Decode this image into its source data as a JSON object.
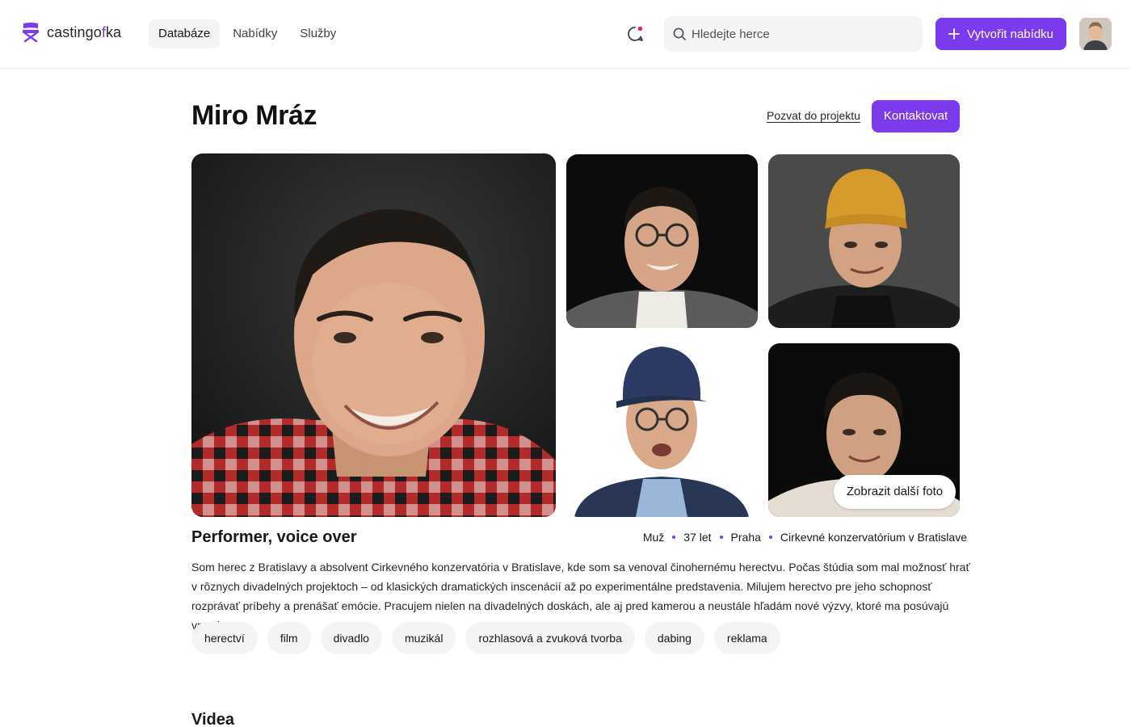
{
  "brand": {
    "name_prefix": "castingo",
    "name_accent": "f",
    "name_suffix": "ka"
  },
  "nav": {
    "items": [
      {
        "label": "Databáze",
        "active": true
      },
      {
        "label": "Nabídky",
        "active": false
      },
      {
        "label": "Služby",
        "active": false
      }
    ]
  },
  "search": {
    "placeholder": "Hledejte herce"
  },
  "header_actions": {
    "create_label": "Vytvořit nabídku"
  },
  "colors": {
    "accent": "#7c3aed",
    "notification_dot": "#e11d48"
  },
  "profile": {
    "name": "Miro Mráz",
    "invite_label": "Pozvat do projektu",
    "contact_label": "Kontaktovat",
    "more_photos_label": "Zobrazit další foto",
    "role": "Performer, voice over",
    "meta": {
      "gender": "Muž",
      "age": "37 let",
      "city": "Praha",
      "school": "Cirkevné konzervatórium v Bratislave"
    },
    "bio": "Som herec z Bratislavy a absolvent Cirkevného konzervatória v Bratislave, kde som sa venoval činohernému herectvu. Počas štúdia som mal možnosť hrať v rôznych divadelných projektoch – od klasických dramatických inscenácií až po experimentálne predstavenia. Milujem herectvo pre jeho schopnosť rozprávať príbehy a prenášať emócie. Pracujem nielen na divadelných doskách, ale aj pred kamerou a neustále hľadám nové výzvy, ktoré ma posúvajú vpred.",
    "tags": [
      "herectví",
      "film",
      "divadlo",
      "muzikál",
      "rozhlasová a zvuková tvorba",
      "dabing",
      "reklama"
    ]
  },
  "sections": {
    "videos_title": "Videa"
  }
}
